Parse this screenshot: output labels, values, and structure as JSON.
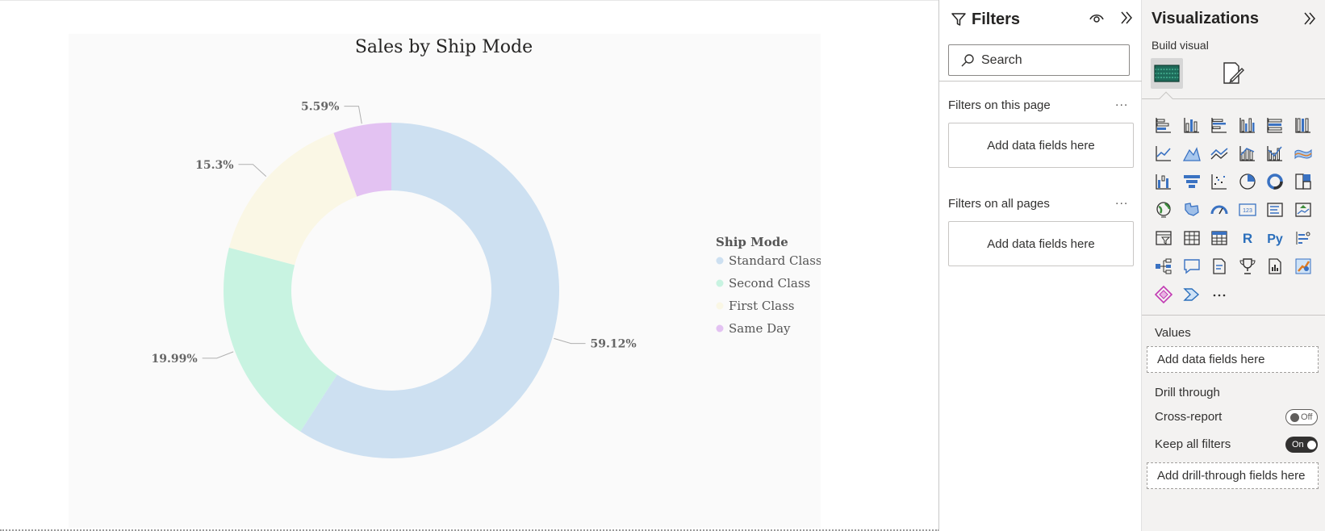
{
  "chart_data": {
    "type": "pie",
    "title": "Sales by Ship Mode",
    "legend_title": "Ship Mode",
    "legend_position": "right",
    "categories": [
      "Standard Class",
      "Second Class",
      "First Class",
      "Same Day"
    ],
    "values": [
      59.12,
      19.99,
      15.3,
      5.59
    ],
    "labels": [
      "59.12%",
      "19.99%",
      "15.3%",
      "5.59%"
    ],
    "colors": [
      "#cde0f1",
      "#c8f3e1",
      "#faf7e5",
      "#e3c2f2"
    ],
    "donut": true
  },
  "filters": {
    "title": "Filters",
    "search_placeholder": "Search",
    "page_section": "Filters on this page",
    "all_section": "Filters on all pages",
    "drop_label": "Add data fields here",
    "more": "..."
  },
  "viz": {
    "title": "Visualizations",
    "build_label": "Build visual",
    "values_label": "Values",
    "values_drop": "Add data fields here",
    "drill_label": "Drill through",
    "cross_report": "Cross-report",
    "cross_report_state": "Off",
    "keep_filters": "Keep all filters",
    "keep_filters_state": "On",
    "drill_drop": "Add drill-through fields here",
    "more": "...",
    "icons": [
      "stacked-bar-chart-icon",
      "stacked-column-chart-icon",
      "clustered-bar-chart-icon",
      "clustered-column-chart-icon",
      "100-stacked-bar-chart-icon",
      "100-stacked-column-chart-icon",
      "line-chart-icon",
      "area-chart-icon",
      "stacked-area-chart-icon",
      "line-stacked-column-chart-icon",
      "line-clustered-column-chart-icon",
      "ribbon-chart-icon",
      "waterfall-chart-icon",
      "funnel-chart-icon",
      "scatter-chart-icon",
      "pie-chart-icon",
      "donut-chart-icon",
      "treemap-icon",
      "map-icon",
      "filled-map-icon",
      "gauge-icon",
      "card-icon",
      "multi-row-card-icon",
      "kpi-icon",
      "slicer-icon",
      "table-icon",
      "matrix-icon",
      "r-visual-icon",
      "python-visual-icon",
      "key-influencers-icon",
      "decomposition-tree-icon",
      "qna-icon",
      "smart-narrative-icon",
      "trophy-icon",
      "paginated-report-icon",
      "azure-map-icon",
      "power-apps-icon",
      "power-automate-icon",
      "more-visuals-icon"
    ]
  }
}
